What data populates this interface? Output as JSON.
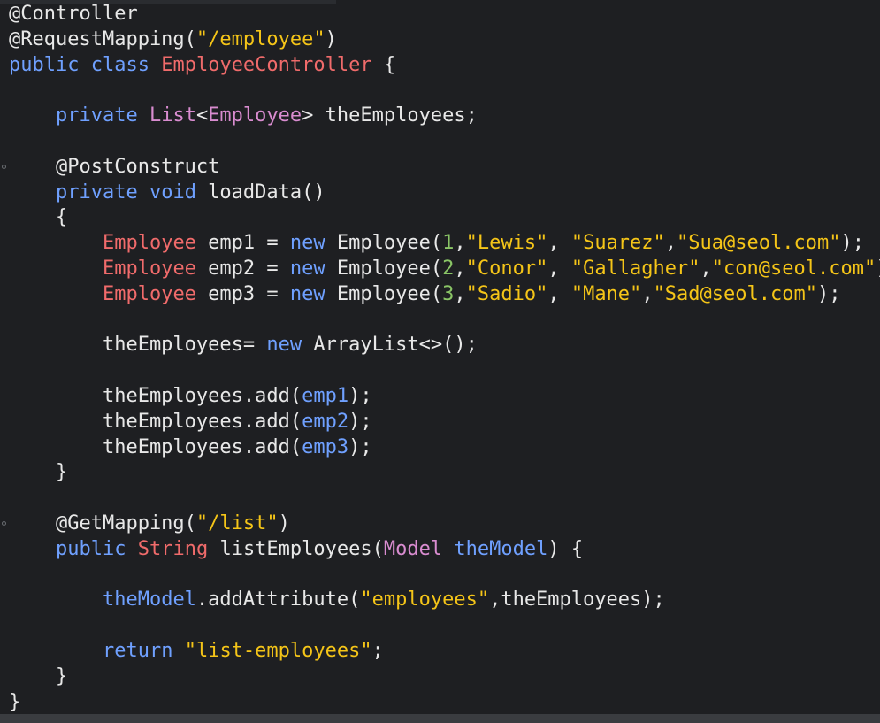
{
  "editor": {
    "language": "java",
    "colors": {
      "background": "#1e1f22",
      "text": "#e8e8e8",
      "keyword": "#6fa0ff",
      "type": "#f06b6b",
      "string": "#f5c518",
      "number": "#8ac566",
      "generic": "#d98cd0"
    },
    "fold_marker_icon": "fold-circle-icon",
    "lines": [
      [
        {
          "t": "@Controller",
          "c": "ann"
        }
      ],
      [
        {
          "t": "@RequestMapping(",
          "c": "ann"
        },
        {
          "t": "\"/employee\"",
          "c": "str"
        },
        {
          "t": ")",
          "c": "plain"
        }
      ],
      [
        {
          "t": "public",
          "c": "kw"
        },
        {
          "t": " ",
          "c": "plain"
        },
        {
          "t": "class",
          "c": "kw"
        },
        {
          "t": " ",
          "c": "plain"
        },
        {
          "t": "EmployeeController",
          "c": "type"
        },
        {
          "t": " {",
          "c": "plain"
        }
      ],
      [],
      [
        {
          "t": "    ",
          "c": "plain"
        },
        {
          "t": "private",
          "c": "kw"
        },
        {
          "t": " ",
          "c": "plain"
        },
        {
          "t": "List",
          "c": "gen"
        },
        {
          "t": "<",
          "c": "plain"
        },
        {
          "t": "Employee",
          "c": "gen"
        },
        {
          "t": "> theEmployees;",
          "c": "plain"
        }
      ],
      [],
      [
        {
          "t": "    @PostConstruct",
          "c": "ann"
        }
      ],
      [
        {
          "t": "    ",
          "c": "plain"
        },
        {
          "t": "private",
          "c": "kw"
        },
        {
          "t": " ",
          "c": "plain"
        },
        {
          "t": "void",
          "c": "kw"
        },
        {
          "t": " loadData()",
          "c": "plain"
        }
      ],
      [
        {
          "t": "    {",
          "c": "plain"
        }
      ],
      [
        {
          "t": "        ",
          "c": "plain"
        },
        {
          "t": "Employee",
          "c": "type"
        },
        {
          "t": " emp1 = ",
          "c": "plain"
        },
        {
          "t": "new",
          "c": "kw"
        },
        {
          "t": " Employee(",
          "c": "plain"
        },
        {
          "t": "1",
          "c": "num"
        },
        {
          "t": ",",
          "c": "plain"
        },
        {
          "t": "\"Lewis\"",
          "c": "str"
        },
        {
          "t": ", ",
          "c": "plain"
        },
        {
          "t": "\"Suarez\"",
          "c": "str"
        },
        {
          "t": ",",
          "c": "plain"
        },
        {
          "t": "\"Sua@seol.com\"",
          "c": "str"
        },
        {
          "t": ");",
          "c": "plain"
        }
      ],
      [
        {
          "t": "        ",
          "c": "plain"
        },
        {
          "t": "Employee",
          "c": "type"
        },
        {
          "t": " emp2 = ",
          "c": "plain"
        },
        {
          "t": "new",
          "c": "kw"
        },
        {
          "t": " Employee(",
          "c": "plain"
        },
        {
          "t": "2",
          "c": "num"
        },
        {
          "t": ",",
          "c": "plain"
        },
        {
          "t": "\"Conor\"",
          "c": "str"
        },
        {
          "t": ", ",
          "c": "plain"
        },
        {
          "t": "\"Gallagher\"",
          "c": "str"
        },
        {
          "t": ",",
          "c": "plain"
        },
        {
          "t": "\"con@seol.com\"",
          "c": "str"
        },
        {
          "t": ");",
          "c": "plain"
        }
      ],
      [
        {
          "t": "        ",
          "c": "plain"
        },
        {
          "t": "Employee",
          "c": "type"
        },
        {
          "t": " emp3 = ",
          "c": "plain"
        },
        {
          "t": "new",
          "c": "kw"
        },
        {
          "t": " Employee(",
          "c": "plain"
        },
        {
          "t": "3",
          "c": "num"
        },
        {
          "t": ",",
          "c": "plain"
        },
        {
          "t": "\"Sadio\"",
          "c": "str"
        },
        {
          "t": ", ",
          "c": "plain"
        },
        {
          "t": "\"Mane\"",
          "c": "str"
        },
        {
          "t": ",",
          "c": "plain"
        },
        {
          "t": "\"Sad@seol.com\"",
          "c": "str"
        },
        {
          "t": ");",
          "c": "plain"
        }
      ],
      [],
      [
        {
          "t": "        theEmployees= ",
          "c": "plain"
        },
        {
          "t": "new",
          "c": "kw"
        },
        {
          "t": " ArrayList<>();",
          "c": "plain"
        }
      ],
      [],
      [
        {
          "t": "        theEmployees.add(",
          "c": "plain"
        },
        {
          "t": "emp1",
          "c": "var"
        },
        {
          "t": ");",
          "c": "plain"
        }
      ],
      [
        {
          "t": "        theEmployees.add(",
          "c": "plain"
        },
        {
          "t": "emp2",
          "c": "var"
        },
        {
          "t": ");",
          "c": "plain"
        }
      ],
      [
        {
          "t": "        theEmployees.add(",
          "c": "plain"
        },
        {
          "t": "emp3",
          "c": "var"
        },
        {
          "t": ");",
          "c": "plain"
        }
      ],
      [
        {
          "t": "    }",
          "c": "plain"
        }
      ],
      [],
      [
        {
          "t": "    @GetMapping(",
          "c": "ann"
        },
        {
          "t": "\"/list\"",
          "c": "str"
        },
        {
          "t": ")",
          "c": "plain"
        }
      ],
      [
        {
          "t": "    ",
          "c": "plain"
        },
        {
          "t": "public",
          "c": "kw"
        },
        {
          "t": " ",
          "c": "plain"
        },
        {
          "t": "String",
          "c": "type"
        },
        {
          "t": " listEmployees(",
          "c": "plain"
        },
        {
          "t": "Model",
          "c": "gen"
        },
        {
          "t": " ",
          "c": "plain"
        },
        {
          "t": "theModel",
          "c": "var"
        },
        {
          "t": ") {",
          "c": "plain"
        }
      ],
      [],
      [
        {
          "t": "        ",
          "c": "plain"
        },
        {
          "t": "theModel",
          "c": "var"
        },
        {
          "t": ".addAttribute(",
          "c": "plain"
        },
        {
          "t": "\"employees\"",
          "c": "str"
        },
        {
          "t": ",theEmployees);",
          "c": "plain"
        }
      ],
      [],
      [
        {
          "t": "        ",
          "c": "plain"
        },
        {
          "t": "return",
          "c": "kw"
        },
        {
          "t": " ",
          "c": "plain"
        },
        {
          "t": "\"list-employees\"",
          "c": "str"
        },
        {
          "t": ";",
          "c": "plain"
        }
      ],
      [
        {
          "t": "    }",
          "c": "plain"
        }
      ],
      [
        {
          "t": "}",
          "c": "plain"
        }
      ]
    ],
    "fold_marker_lines": [
      6,
      20
    ]
  }
}
